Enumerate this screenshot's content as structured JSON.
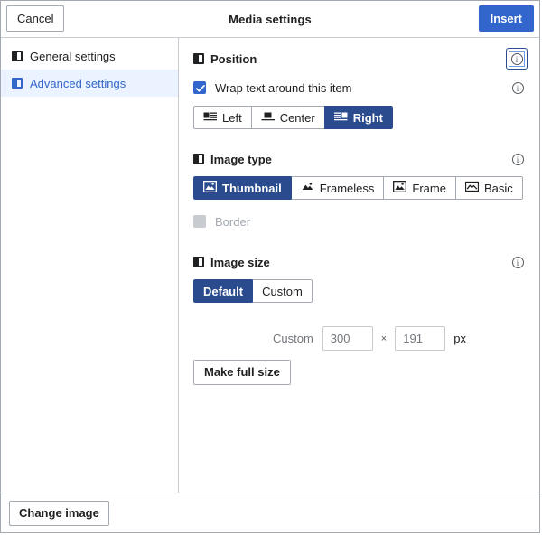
{
  "dialog": {
    "title": "Media settings",
    "cancel_label": "Cancel",
    "insert_label": "Insert"
  },
  "sidebar": {
    "items": [
      {
        "label": "General settings",
        "selected": false
      },
      {
        "label": "Advanced settings",
        "selected": true
      }
    ]
  },
  "main": {
    "position": {
      "title": "Position",
      "wrap_checkbox_label": "Wrap text around this item",
      "wrap_checked": true,
      "options": [
        {
          "label": "Left",
          "icon": "align-left-icon",
          "active": false
        },
        {
          "label": "Center",
          "icon": "align-center-icon",
          "active": false
        },
        {
          "label": "Right",
          "icon": "align-right-icon",
          "active": true
        }
      ],
      "info_label": "i"
    },
    "image_type": {
      "title": "Image type",
      "options": [
        {
          "label": "Thumbnail",
          "icon": "image-thumbnail-icon",
          "active": true
        },
        {
          "label": "Frameless",
          "icon": "image-frameless-icon",
          "active": false
        },
        {
          "label": "Frame",
          "icon": "image-frame-icon",
          "active": false
        },
        {
          "label": "Basic",
          "icon": "image-basic-icon",
          "active": false
        }
      ],
      "border_label": "Border",
      "border_checked": false,
      "border_disabled": true,
      "info_label": "i"
    },
    "image_size": {
      "title": "Image size",
      "options": [
        {
          "label": "Default",
          "active": true
        },
        {
          "label": "Custom",
          "active": false
        }
      ],
      "custom_label": "Custom",
      "width_value": "300",
      "height_value": "191",
      "separator": "×",
      "unit_label": "px",
      "make_full_size_label": "Make full size",
      "info_label": "i"
    }
  },
  "footer": {
    "change_image_label": "Change image"
  },
  "colors": {
    "progressive": "#3366cc",
    "progressive_active": "#2a4b8d",
    "border": "#a2a9b1",
    "selected_bg": "#eaf3ff",
    "disabled": "#c8ccd1"
  }
}
